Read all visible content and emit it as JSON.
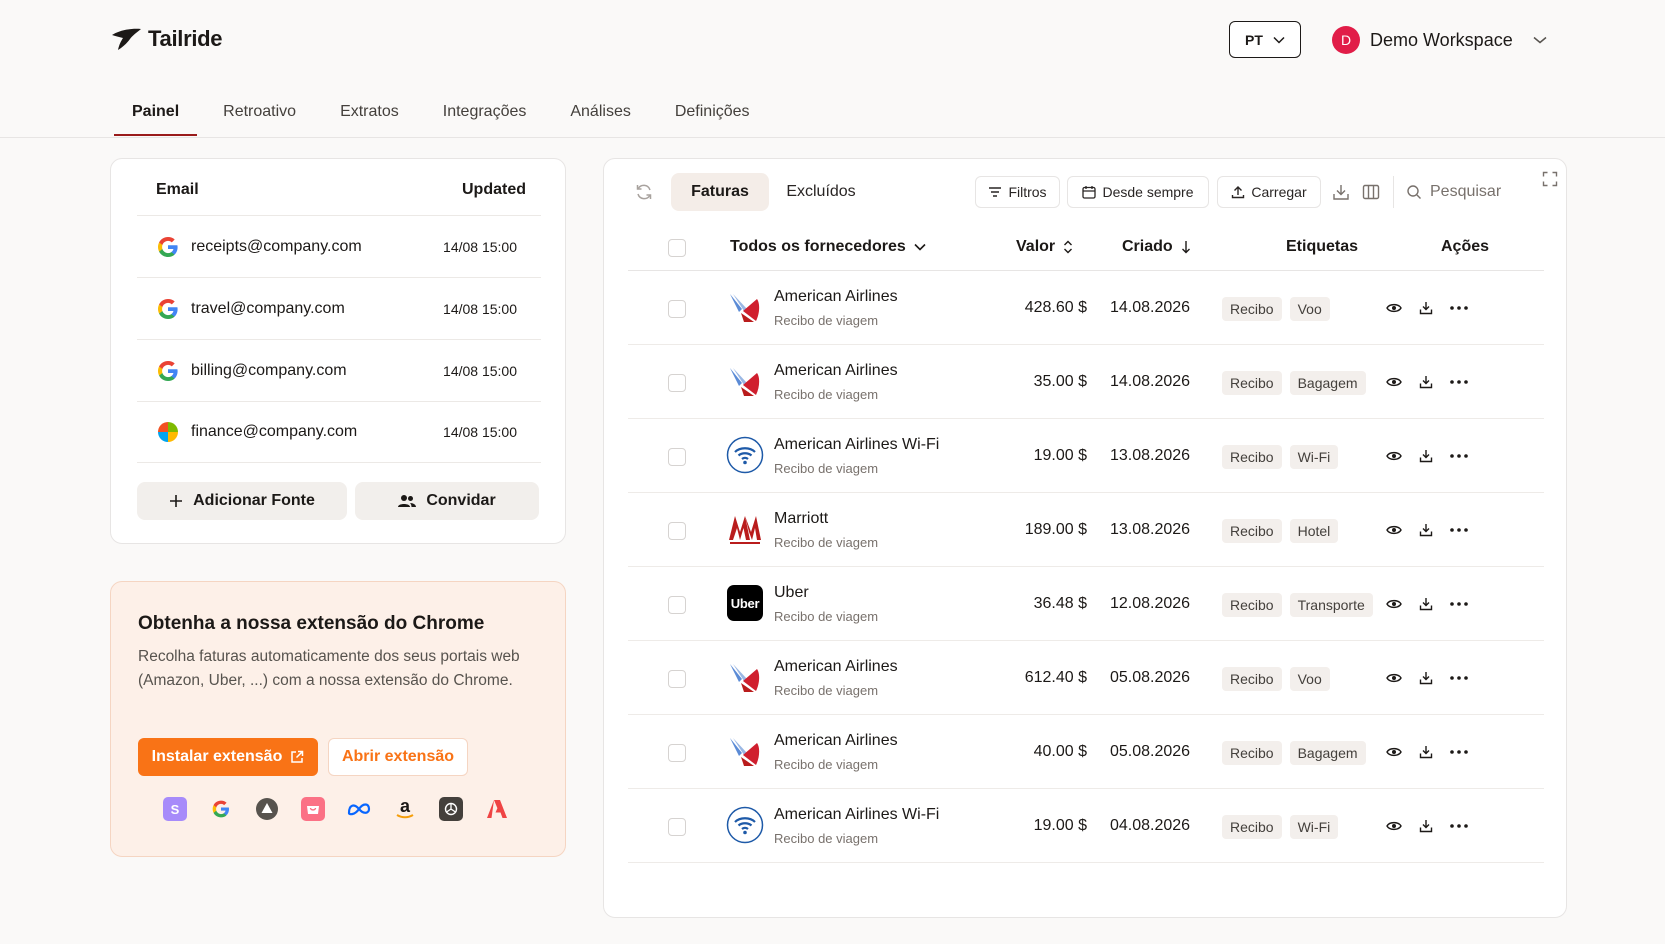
{
  "app": {
    "name": "Tailride"
  },
  "header": {
    "lang": "PT",
    "workspace_initial": "D",
    "workspace_name": "Demo Workspace"
  },
  "nav": {
    "tabs": [
      "Painel",
      "Retroativo",
      "Extratos",
      "Integrações",
      "Análises",
      "Definições"
    ],
    "active": "Painel"
  },
  "sources": {
    "col_email": "Email",
    "col_updated": "Updated",
    "rows": [
      {
        "email": "receipts@company.com",
        "updated": "14/08 15:00",
        "provider": "google"
      },
      {
        "email": "travel@company.com",
        "updated": "14/08 15:00",
        "provider": "google"
      },
      {
        "email": "billing@company.com",
        "updated": "14/08 15:00",
        "provider": "google"
      },
      {
        "email": "finance@company.com",
        "updated": "14/08 15:00",
        "provider": "microsoft"
      }
    ],
    "add_label": "Adicionar Fonte",
    "invite_label": "Convidar"
  },
  "chrome_ext": {
    "title": "Obtenha a nossa extensão do Chrome",
    "description": "Recolha faturas automaticamente dos seus portais web (Amazon, Uber, ...) com a nossa extensão do Chrome.",
    "install_label": "Instalar extensão",
    "open_label": "Abrir extensão",
    "brands": [
      "stripe-icon",
      "google-icon",
      "vercel-icon",
      "shopify-icon",
      "meta-icon",
      "amazon-icon",
      "openai-icon",
      "adobe-icon"
    ]
  },
  "invoices": {
    "tab_invoices": "Faturas",
    "tab_excluded": "Excluídos",
    "filters_label": "Filtros",
    "period_label": "Desde sempre",
    "upload_label": "Carregar",
    "search_placeholder": "Pesquisar",
    "col_vendor": "Todos os fornecedores",
    "col_amount": "Valor",
    "col_created": "Criado",
    "col_tags": "Etiquetas",
    "col_actions": "Ações",
    "rows": [
      {
        "vendor": "American Airlines",
        "type": "Recibo de viagem",
        "amount": "428.60 $",
        "created": "14.08.2026",
        "tag1": "Recibo",
        "tag2": "Voo",
        "logo": "american-airlines"
      },
      {
        "vendor": "American Airlines",
        "type": "Recibo de viagem",
        "amount": "35.00 $",
        "created": "14.08.2026",
        "tag1": "Recibo",
        "tag2": "Bagagem",
        "logo": "american-airlines"
      },
      {
        "vendor": "American Airlines Wi-Fi",
        "type": "Recibo de viagem",
        "amount": "19.00 $",
        "created": "13.08.2026",
        "tag1": "Recibo",
        "tag2": "Wi-Fi",
        "logo": "wifi"
      },
      {
        "vendor": "Marriott",
        "type": "Recibo de viagem",
        "amount": "189.00 $",
        "created": "13.08.2026",
        "tag1": "Recibo",
        "tag2": "Hotel",
        "logo": "marriott"
      },
      {
        "vendor": "Uber",
        "type": "Recibo de viagem",
        "amount": "36.48 $",
        "created": "12.08.2026",
        "tag1": "Recibo",
        "tag2": "Transporte",
        "logo": "uber"
      },
      {
        "vendor": "American Airlines",
        "type": "Recibo de viagem",
        "amount": "612.40 $",
        "created": "05.08.2026",
        "tag1": "Recibo",
        "tag2": "Voo",
        "logo": "american-airlines"
      },
      {
        "vendor": "American Airlines",
        "type": "Recibo de viagem",
        "amount": "40.00 $",
        "created": "05.08.2026",
        "tag1": "Recibo",
        "tag2": "Bagagem",
        "logo": "american-airlines"
      },
      {
        "vendor": "American Airlines Wi-Fi",
        "type": "Recibo de viagem",
        "amount": "19.00 $",
        "created": "04.08.2026",
        "tag1": "Recibo",
        "tag2": "Wi-Fi",
        "logo": "wifi"
      }
    ]
  },
  "colors": {
    "accent": "#f97316",
    "nav_underline": "#991b1b",
    "avatar": "#e11d48"
  }
}
